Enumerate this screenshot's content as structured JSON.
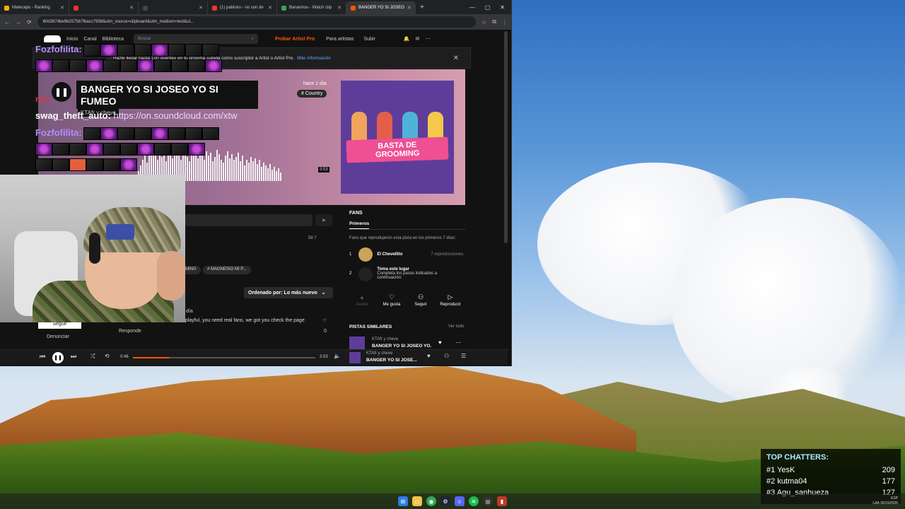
{
  "browser": {
    "tabs": [
      {
        "label": "Matecapo - Ranking",
        "color": "#f4b400"
      },
      {
        "label": "",
        "color": "#e33"
      },
      {
        "label": "",
        "color": "#444"
      },
      {
        "label": "(1) pabloxo - no son de",
        "color": "#e33"
      },
      {
        "label": "Bananirou - Watch clip",
        "color": "#34a853"
      },
      {
        "label": "BANGER YO SI JOSEO",
        "color": "#ff5500"
      }
    ],
    "url": "60d3674be9b2575b7fbacc7958&utm_source=clipboard&utm_medium=text&ut..."
  },
  "soundcloud": {
    "nav": {
      "home": "Inicio",
      "feed": "Canal",
      "library": "Biblioteca",
      "search_placeholder": "Buscar",
      "try_pro": "Probar Artist Pro",
      "for_artists": "Para artistas",
      "upload": "Subir"
    },
    "banner": {
      "text": "...: Hazle llegar hasta 100 oyentes en tu próxima subida como suscriptor a Artist o Artist Pro.",
      "link": "Más información"
    },
    "track": {
      "title": "BANGER YO SI JOSEO YO SI FUMEO",
      "artist": "KTAfr y cheve",
      "posted": "hace 1 día",
      "tag": "# Country",
      "duration_marker": "3:53"
    },
    "artwork": {
      "line1": "BASTA DE",
      "line2": "GROOMING"
    },
    "comments": {
      "stats": "58   7",
      "tags": [
        "MING",
        "# MAGNESIO MI P..."
      ],
      "sort_label": "Ordenado por: Lo más nuevo",
      "comment_text": "...playful, you need real fans, we got you check the page",
      "time": "día",
      "reply": "Responde",
      "count": "0",
      "report": "Denunciar",
      "follow": "Seguir"
    },
    "fans": {
      "title": "FANS",
      "tab": "Primeros",
      "description": "Fans que reprodujeron esta pista en los primeros 7 días:",
      "rows": [
        {
          "rank": "1",
          "name": "El Chevellito",
          "plays": "7 reproducciones"
        },
        {
          "rank": "2",
          "name": "Toma este lugar",
          "sub": "Completa los pasos indicados a continuación:"
        }
      ],
      "actions": {
        "avatar": "Avatar",
        "like": "Me gusta",
        "follow": "Seguir",
        "play": "Reproducir"
      }
    },
    "similar": {
      "title": "PISTAS SIMILARES",
      "see_all": "Ver todo",
      "artist": "KTAfr y cheve",
      "track": "BANGER YO SI JOSEO YO..."
    },
    "player": {
      "current": "0:46",
      "total": "3:53",
      "progress": 0.2,
      "artist": "KTAfr y cheve",
      "title": "BANGER YO SI JOSE..."
    }
  },
  "chat": {
    "lines": [
      {
        "user": "Fozfofilita:",
        "color": "#b48cff"
      },
      {
        "user": "swag_theft_auto:",
        "color": "#ffffff",
        "text": "https://on.soundcloud.com/xtw"
      },
      {
        "user": "Fozfofilita:",
        "color": "#b48cff"
      },
      {
        "user": "nyc",
        "color": "#d63b3b"
      }
    ]
  },
  "top_chatters": {
    "title": "TOP CHATTERS:",
    "entries": [
      {
        "rank": "#1",
        "name": "YesK",
        "count": "209"
      },
      {
        "rank": "#2",
        "name": "kutma04",
        "count": "177"
      },
      {
        "rank": "#3",
        "name": "Agu_sanhueza",
        "count": "127"
      }
    ]
  },
  "taskbar": {
    "lang": "ESP",
    "region": "LAA",
    "date": "26/10/2025"
  }
}
